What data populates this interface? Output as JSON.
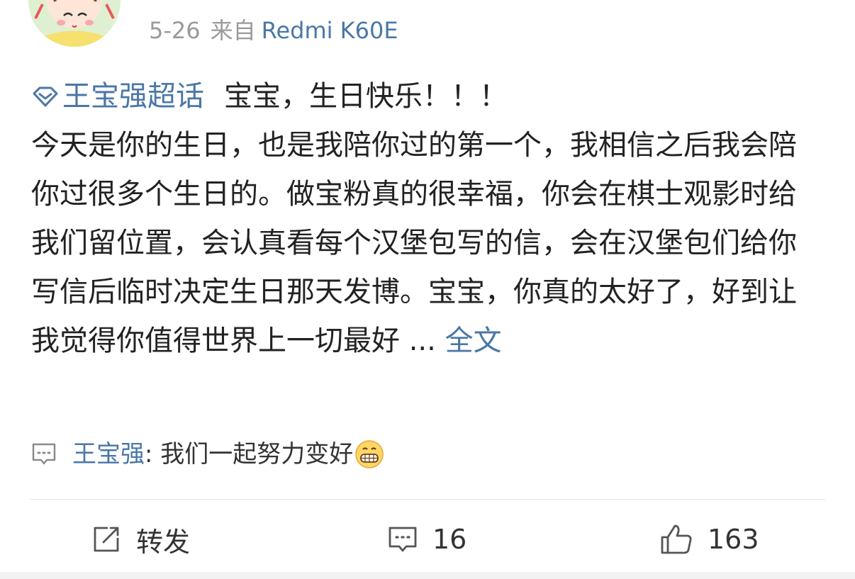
{
  "post": {
    "date": "5-26",
    "from_label": "来自",
    "device": "Redmi K60E",
    "topic_icon": "diamond-topic-icon",
    "topic": "王宝强超话",
    "headline": "宝宝，生日快乐！！！",
    "body": "今天是你的生日，也是我陪你过的第一个，我相信之后我会陪你过很多个生日的。做宝粉真的很幸福，你会在棋士观影时给我们留位置，会认真看每个汉堡包写的信，会在汉堡包们给你写信后临时决定生日那天发博。宝宝，你真的太好了，好到让我觉得你值得世界上一切最好 ...",
    "full_text_link": "全文"
  },
  "top_comment": {
    "icon": "comment-bubble-icon",
    "user": "王宝强",
    "text": ": 我们一起努力变好",
    "emoji": "grinning-face-emoji"
  },
  "actions": {
    "repost_label": "转发",
    "comment_count": "16",
    "like_count": "163"
  },
  "colors": {
    "link": "#4a77a6",
    "meta_gray": "#9a9a9a",
    "text": "#222222",
    "divider": "#e6e6e6"
  }
}
